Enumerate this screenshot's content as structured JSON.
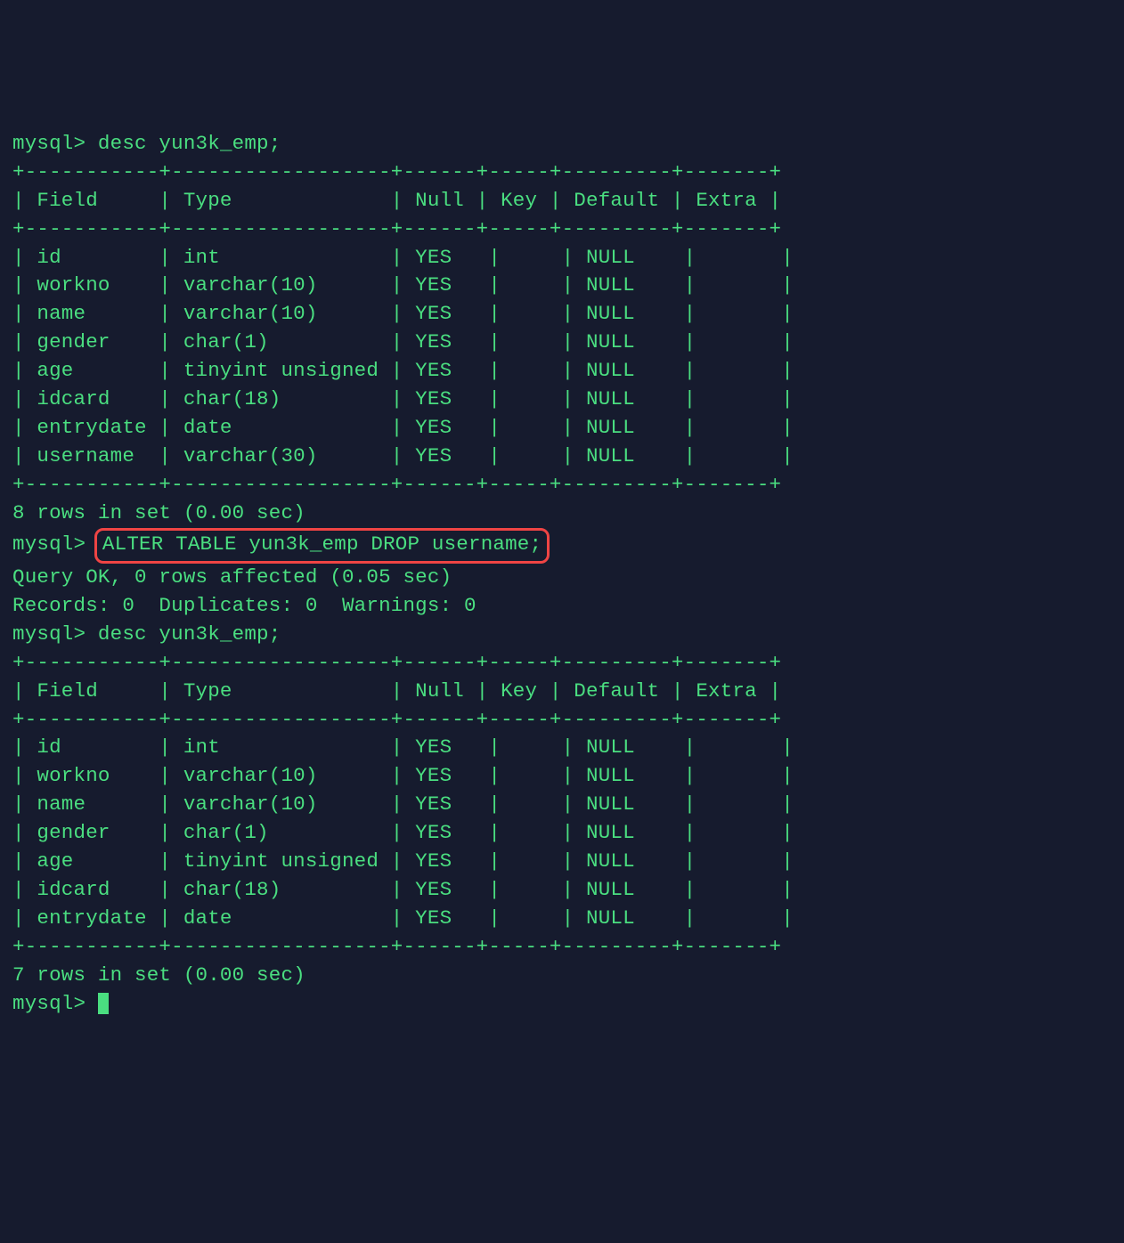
{
  "prompt": "mysql>",
  "commands": {
    "desc1": "desc yun3k_emp;",
    "alter": "ALTER TABLE yun3k_emp DROP username;",
    "desc2": "desc yun3k_emp;"
  },
  "table_border_full": "+-----------+------------------+------+-----+---------+-------+",
  "headers": {
    "field": "Field",
    "type": "Type",
    "null": "Null",
    "key": "Key",
    "default": "Default",
    "extra": "Extra"
  },
  "table1_rows": [
    {
      "field": "id",
      "type": "int",
      "null": "YES",
      "key": "",
      "default": "NULL",
      "extra": ""
    },
    {
      "field": "workno",
      "type": "varchar(10)",
      "null": "YES",
      "key": "",
      "default": "NULL",
      "extra": ""
    },
    {
      "field": "name",
      "type": "varchar(10)",
      "null": "YES",
      "key": "",
      "default": "NULL",
      "extra": ""
    },
    {
      "field": "gender",
      "type": "char(1)",
      "null": "YES",
      "key": "",
      "default": "NULL",
      "extra": ""
    },
    {
      "field": "age",
      "type": "tinyint unsigned",
      "null": "YES",
      "key": "",
      "default": "NULL",
      "extra": ""
    },
    {
      "field": "idcard",
      "type": "char(18)",
      "null": "YES",
      "key": "",
      "default": "NULL",
      "extra": ""
    },
    {
      "field": "entrydate",
      "type": "date",
      "null": "YES",
      "key": "",
      "default": "NULL",
      "extra": ""
    },
    {
      "field": "username",
      "type": "varchar(30)",
      "null": "YES",
      "key": "",
      "default": "NULL",
      "extra": ""
    }
  ],
  "table1_summary": "8 rows in set (0.00 sec)",
  "alter_result1": "Query OK, 0 rows affected (0.05 sec)",
  "alter_result2": "Records: 0  Duplicates: 0  Warnings: 0",
  "table2_rows": [
    {
      "field": "id",
      "type": "int",
      "null": "YES",
      "key": "",
      "default": "NULL",
      "extra": ""
    },
    {
      "field": "workno",
      "type": "varchar(10)",
      "null": "YES",
      "key": "",
      "default": "NULL",
      "extra": ""
    },
    {
      "field": "name",
      "type": "varchar(10)",
      "null": "YES",
      "key": "",
      "default": "NULL",
      "extra": ""
    },
    {
      "field": "gender",
      "type": "char(1)",
      "null": "YES",
      "key": "",
      "default": "NULL",
      "extra": ""
    },
    {
      "field": "age",
      "type": "tinyint unsigned",
      "null": "YES",
      "key": "",
      "default": "NULL",
      "extra": ""
    },
    {
      "field": "idcard",
      "type": "char(18)",
      "null": "YES",
      "key": "",
      "default": "NULL",
      "extra": ""
    },
    {
      "field": "entrydate",
      "type": "date",
      "null": "YES",
      "key": "",
      "default": "NULL",
      "extra": ""
    }
  ],
  "table2_summary": "7 rows in set (0.00 sec)",
  "col_widths": {
    "field": 9,
    "type": 16,
    "null": 4,
    "key": 3,
    "default": 7,
    "extra": 5
  }
}
